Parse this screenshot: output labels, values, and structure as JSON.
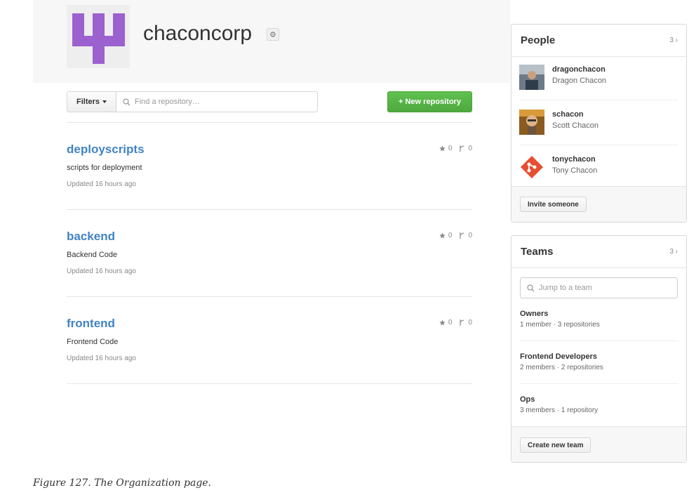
{
  "org": {
    "name": "chaconcorp",
    "avatar_icon": "trident-logo",
    "avatar_color": "#9b61cf",
    "settings_icon": "gear-icon"
  },
  "toolbar": {
    "filters_label": "Filters",
    "find_placeholder": "Find a repository…",
    "new_repo_label": "New repository",
    "new_repo_prefix": "+"
  },
  "repos": [
    {
      "name": "deployscripts",
      "description": "scripts for deployment",
      "updated": "Updated 16 hours ago",
      "stars": "0",
      "forks": "0"
    },
    {
      "name": "backend",
      "description": "Backend Code",
      "updated": "Updated 16 hours ago",
      "stars": "0",
      "forks": "0"
    },
    {
      "name": "frontend",
      "description": "Frontend Code",
      "updated": "Updated 16 hours ago",
      "stars": "0",
      "forks": "0"
    }
  ],
  "people": {
    "title": "People",
    "count": "3",
    "members": [
      {
        "login": "dragonchacon",
        "name": "Dragon Chacon"
      },
      {
        "login": "schacon",
        "name": "Scott Chacon"
      },
      {
        "login": "tonychacon",
        "name": "Tony Chacon"
      }
    ],
    "invite_label": "Invite someone"
  },
  "teams": {
    "title": "Teams",
    "count": "3",
    "search_placeholder": "Jump to a team",
    "items": [
      {
        "name": "Owners",
        "meta": "1 member · 3 repositories"
      },
      {
        "name": "Frontend Developers",
        "meta": "2 members · 2 repositories"
      },
      {
        "name": "Ops",
        "meta": "3 members · 1 repository"
      }
    ],
    "create_label": "Create new team"
  },
  "caption": "Figure 127. The Organization page.",
  "colors": {
    "link": "#4183c4",
    "primary_button": "#55b344",
    "git_logo": "#e84e31"
  }
}
